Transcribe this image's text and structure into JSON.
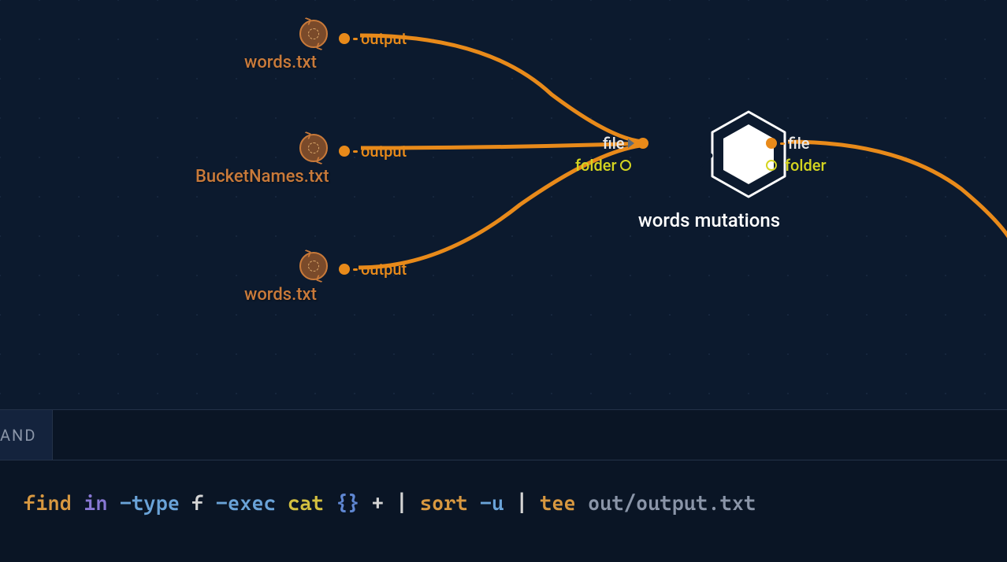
{
  "nodes": {
    "file1": {
      "label": "words.txt",
      "port": "output"
    },
    "file2": {
      "label": "BucketNames.txt",
      "port": "output"
    },
    "file3": {
      "label": "words.txt",
      "port": "output"
    }
  },
  "mutation_node": {
    "label": "words mutations",
    "input_file": "file",
    "input_folder": "folder",
    "output_file": "file",
    "output_folder": "folder"
  },
  "tab_label": "AND",
  "command": {
    "find": "find",
    "in": "in",
    "type_flag": "-type",
    "type_val": "f",
    "exec_flag": "-exec",
    "cat": "cat",
    "braces": "{}",
    "plus": "+",
    "pipe1": "|",
    "sort": "sort",
    "sort_flag": "-u",
    "pipe2": "|",
    "tee": "tee",
    "path": "out/output.txt"
  }
}
